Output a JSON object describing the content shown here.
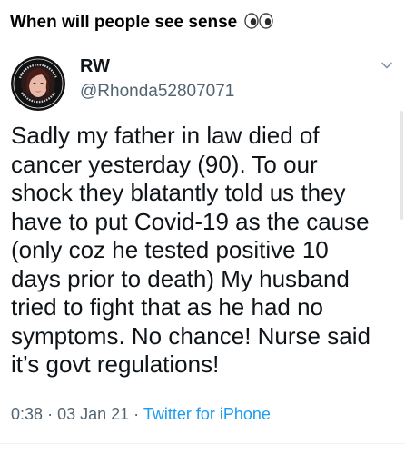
{
  "caption": {
    "text": "When will people see sense"
  },
  "tweet": {
    "display_name": "RW",
    "handle": "@Rhonda52807071",
    "avatar_badge_top": "Whistleblowers",
    "avatar_badge_bottom": "Whistleblowers",
    "text": "Sadly my father in law died of\ncancer yesterday (90). To our\nshock they blatantly told us they\nhave to put Covid-19 as the cause\n(only coz he tested positive 10\ndays prior to death) My husband\ntried to fight that as he had no\nsymptoms. No chance! Nurse said\nit’s govt regulations!",
    "time": "0:38",
    "separator": "·",
    "date": "03 Jan 21",
    "source": "Twitter for iPhone",
    "icons": [
      "eyes-emoji",
      "chevron-down-icon"
    ],
    "colors": {
      "link": "#1d9bf0",
      "secondary": "#536471",
      "text": "#0f1419"
    }
  }
}
